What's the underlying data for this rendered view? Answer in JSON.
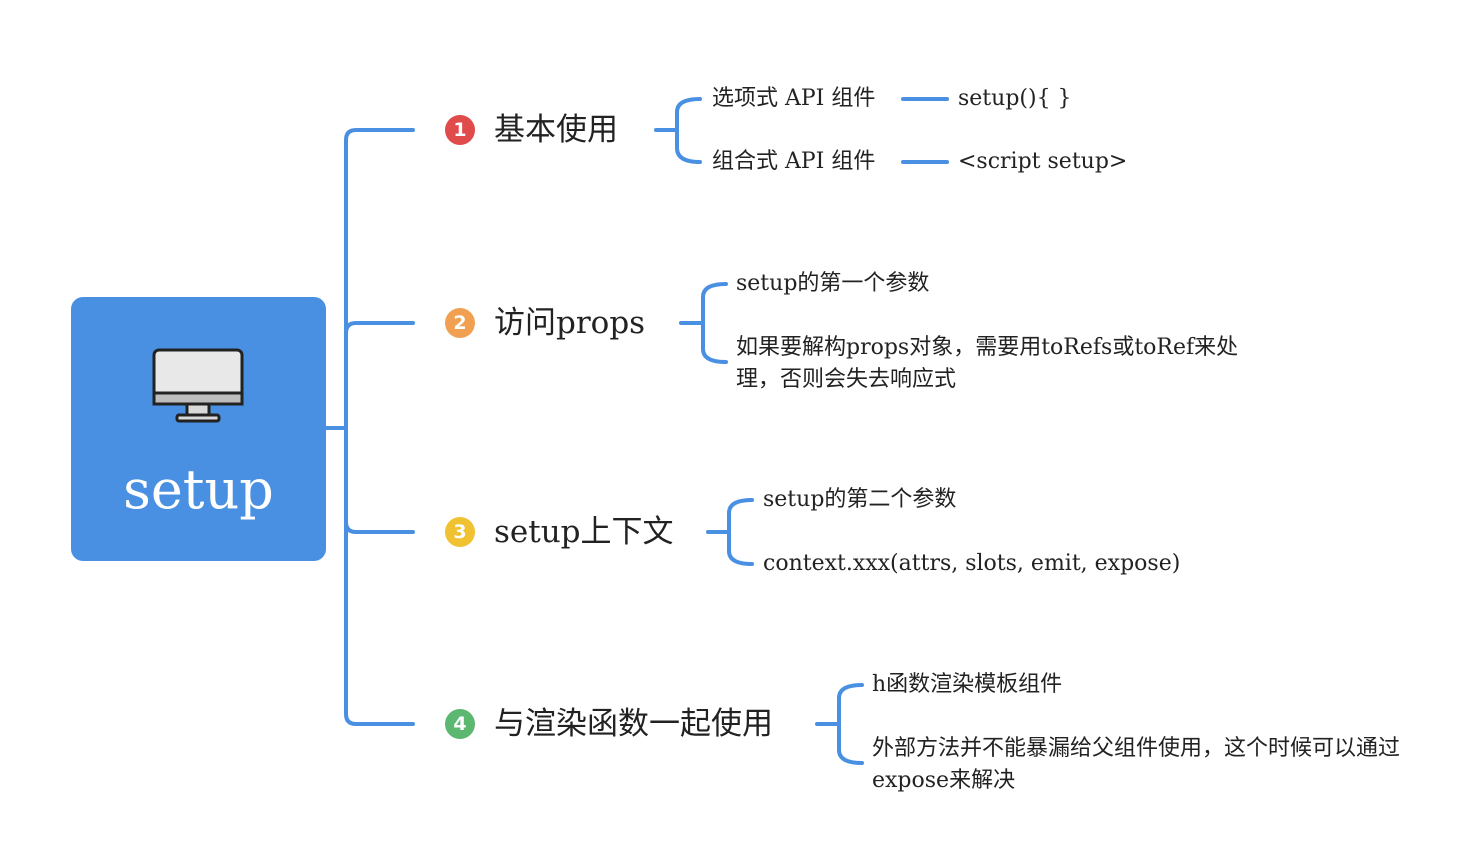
{
  "root": {
    "title": "setup",
    "icon": "desktop-computer-icon",
    "color": "#4a90e2"
  },
  "connector_color": "#4a90e2",
  "branches": [
    {
      "number": "1",
      "badge_color": "#e04b4b",
      "title": "基本使用",
      "items": [
        {
          "label": "选项式 API 组件",
          "value": "setup(){ }"
        },
        {
          "label": "组合式 API 组件",
          "value": "<script setup>"
        }
      ]
    },
    {
      "number": "2",
      "badge_color": "#f0a050",
      "title": "访问props",
      "items": [
        {
          "text": "setup的第一个参数"
        },
        {
          "text": "如果要解构props对象，需要用toRefs或toRef来处理，否则会失去响应式"
        }
      ]
    },
    {
      "number": "3",
      "badge_color": "#f0c232",
      "title": "setup上下文",
      "items": [
        {
          "text": "setup的第二个参数"
        },
        {
          "text": "context.xxx(attrs, slots, emit, expose)"
        }
      ]
    },
    {
      "number": "4",
      "badge_color": "#5cb870",
      "title": "与渲染函数一起使用",
      "items": [
        {
          "text": "h函数渲染模板组件"
        },
        {
          "text": "外部方法并不能暴漏给父组件使用，这个时候可以通过expose来解决"
        }
      ]
    }
  ]
}
